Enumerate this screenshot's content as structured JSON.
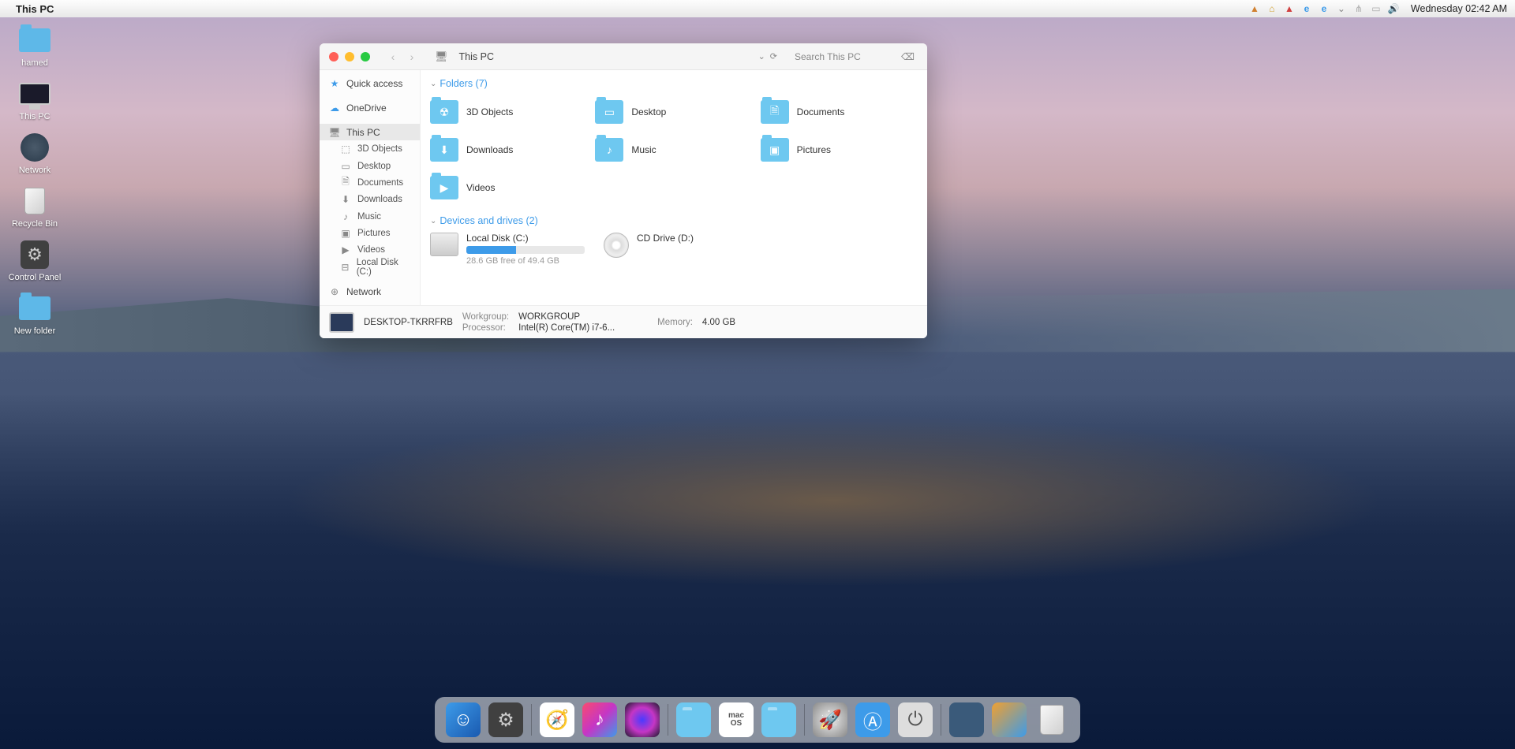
{
  "menubar": {
    "app_name": "This PC",
    "clock": "Wednesday 02:42 AM"
  },
  "desktop_icons": {
    "hamed": "hamed",
    "this_pc": "This PC",
    "network": "Network",
    "recycle_bin": "Recycle Bin",
    "control_panel": "Control Panel",
    "new_folder": "New folder"
  },
  "window": {
    "location": "This PC",
    "search_placeholder": "Search This PC",
    "sidebar": {
      "quick_access": "Quick access",
      "onedrive": "OneDrive",
      "this_pc": "This PC",
      "objects_3d": "3D Objects",
      "desktop": "Desktop",
      "documents": "Documents",
      "downloads": "Downloads",
      "music": "Music",
      "pictures": "Pictures",
      "videos": "Videos",
      "local_disk": "Local Disk (C:)",
      "network": "Network"
    },
    "groups": {
      "folders_header": "Folders (7)",
      "drives_header": "Devices and drives (2)"
    },
    "folders": {
      "objects_3d": "3D Objects",
      "desktop": "Desktop",
      "documents": "Documents",
      "downloads": "Downloads",
      "music": "Music",
      "pictures": "Pictures",
      "videos": "Videos"
    },
    "drives": {
      "local_disk_name": "Local Disk (C:)",
      "local_disk_free": "28.6 GB free of 49.4 GB",
      "local_disk_fill_pct": "42%",
      "cd_drive_name": "CD Drive (D:)"
    },
    "statusbar": {
      "computer_name": "DESKTOP-TKRRFRB",
      "workgroup_label": "Workgroup:",
      "workgroup_value": "WORKGROUP",
      "processor_label": "Processor:",
      "processor_value": "Intel(R) Core(TM) i7-6...",
      "memory_label": "Memory:",
      "memory_value": "4.00 GB"
    }
  }
}
